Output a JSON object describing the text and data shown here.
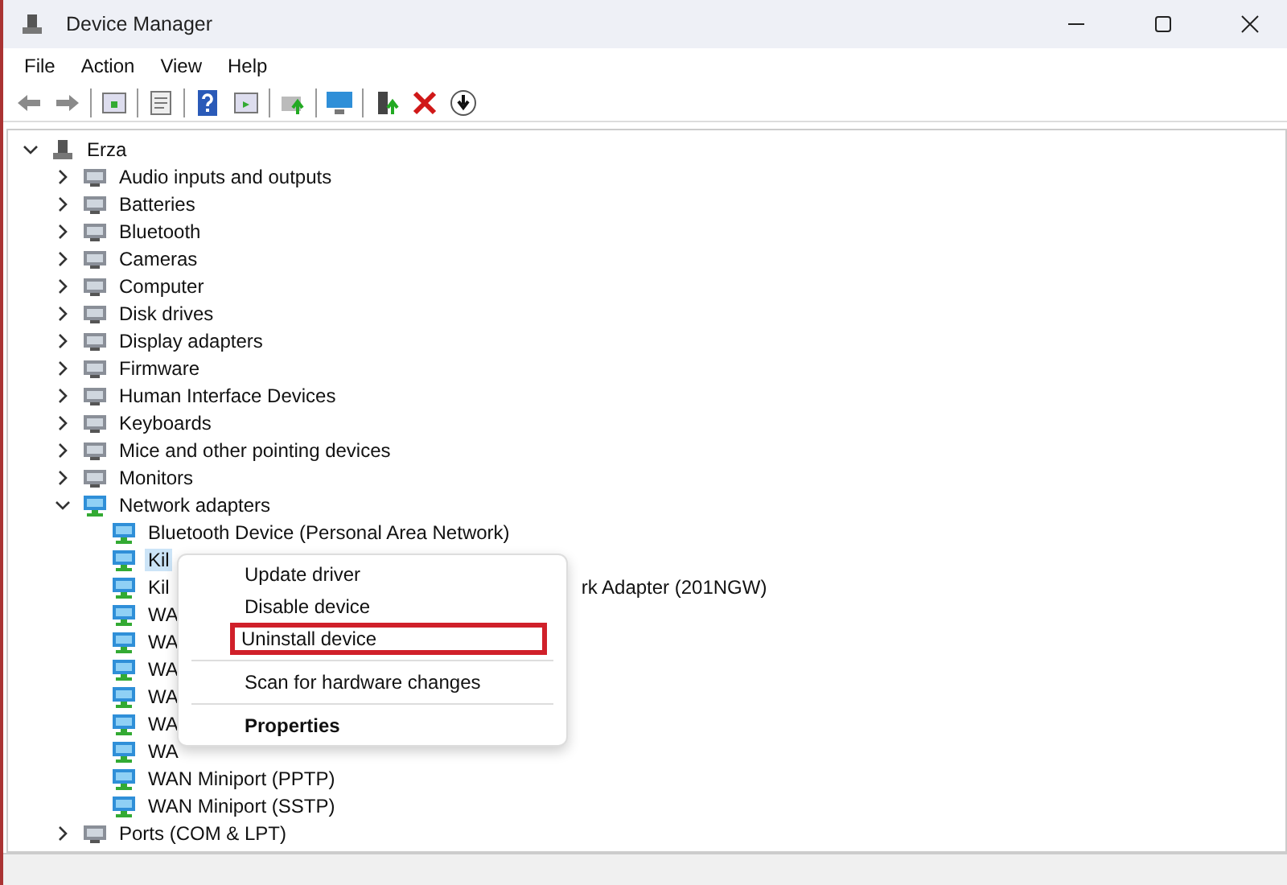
{
  "window": {
    "title": "Device Manager"
  },
  "menu": [
    "File",
    "Action",
    "View",
    "Help"
  ],
  "tree": {
    "label": "Erza",
    "expanded": true,
    "children": [
      {
        "label": "Audio inputs and outputs",
        "expanded": false
      },
      {
        "label": "Batteries",
        "expanded": false
      },
      {
        "label": "Bluetooth",
        "expanded": false
      },
      {
        "label": "Cameras",
        "expanded": false
      },
      {
        "label": "Computer",
        "expanded": false
      },
      {
        "label": "Disk drives",
        "expanded": false
      },
      {
        "label": "Display adapters",
        "expanded": false
      },
      {
        "label": "Firmware",
        "expanded": false
      },
      {
        "label": "Human Interface Devices",
        "expanded": false
      },
      {
        "label": "Keyboards",
        "expanded": false
      },
      {
        "label": "Mice and other pointing devices",
        "expanded": false
      },
      {
        "label": "Monitors",
        "expanded": false
      },
      {
        "label": "Network adapters",
        "expanded": true,
        "children": [
          {
            "label": "Bluetooth Device (Personal Area Network)",
            "selected": false
          },
          {
            "label": "Kil",
            "selected": true
          },
          {
            "label": "Kil",
            "tail": "rk Adapter (201NGW)",
            "selected": false
          },
          {
            "label": "WA",
            "selected": false
          },
          {
            "label": "WA",
            "selected": false
          },
          {
            "label": "WA",
            "selected": false
          },
          {
            "label": "WA",
            "selected": false
          },
          {
            "label": "WA",
            "selected": false
          },
          {
            "label": "WA",
            "selected": false
          },
          {
            "label": "WAN Miniport (PPTP)",
            "selected": false
          },
          {
            "label": "WAN Miniport (SSTP)",
            "selected": false
          }
        ]
      },
      {
        "label": "Ports (COM & LPT)",
        "expanded": false
      }
    ]
  },
  "context_menu": {
    "items": [
      {
        "label": "Update driver",
        "bold": false,
        "highlighted": false,
        "separator_before": false
      },
      {
        "label": "Disable device",
        "bold": false,
        "highlighted": false,
        "separator_before": false
      },
      {
        "label": "Uninstall device",
        "bold": false,
        "highlighted": true,
        "separator_before": false
      },
      {
        "label": "Scan for hardware changes",
        "bold": false,
        "highlighted": false,
        "separator_before": true
      },
      {
        "label": "Properties",
        "bold": true,
        "highlighted": false,
        "separator_before": true
      }
    ]
  }
}
